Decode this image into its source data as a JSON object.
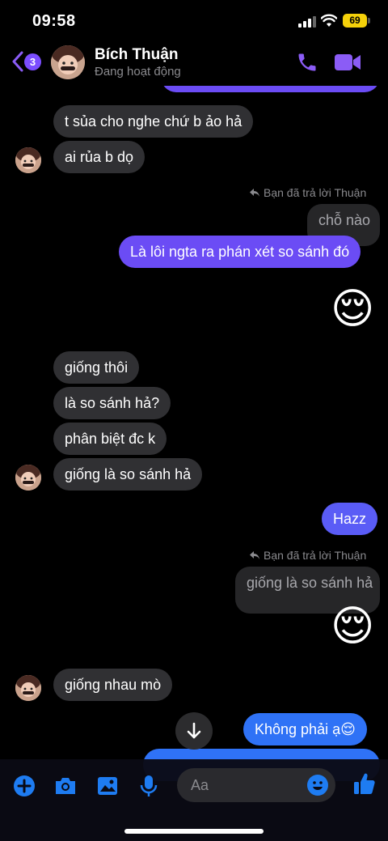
{
  "status_bar": {
    "time": "09:58",
    "battery": "69"
  },
  "header": {
    "back_count": "3",
    "name": "Bích Thuận",
    "status": "Đang hoạt động"
  },
  "messages": {
    "m1": "t sủa cho nghe chứ b ảo hả",
    "m2": "ai rủa b dọ",
    "reply_label_1": "Bạn đã trả lời Thuận",
    "quote_1": "chỗ nào",
    "m3": "Là lôi ngta ra phán xét so sánh đó",
    "m4": "giống thôi",
    "m5": "là so sánh hả?",
    "m6": "phân biệt đc k",
    "m7": "giống là so sánh hả",
    "m8": "Hazz",
    "reply_label_2": "Bạn đã trả lời Thuận",
    "quote_2": "giống là so sánh hả",
    "m9": "giống nhau mò",
    "m10": "Không phải ạ😌"
  },
  "emojis": {
    "e1": "😌",
    "e2": "😌"
  },
  "composer": {
    "placeholder": "Aa"
  },
  "icons": [
    "back-icon",
    "phone-icon",
    "video-camera-icon",
    "reply-arrow-icon",
    "plus-icon",
    "camera-icon",
    "image-icon",
    "microphone-icon",
    "emoji-icon",
    "thumbs-up-icon",
    "arrow-down-icon"
  ],
  "colors": {
    "accent": "#7b4dff",
    "outgoing": "#6b4cf5",
    "outgoing_blue": "#2f72f6",
    "incoming": "#303033",
    "blue_icon": "#1e7cf2"
  }
}
